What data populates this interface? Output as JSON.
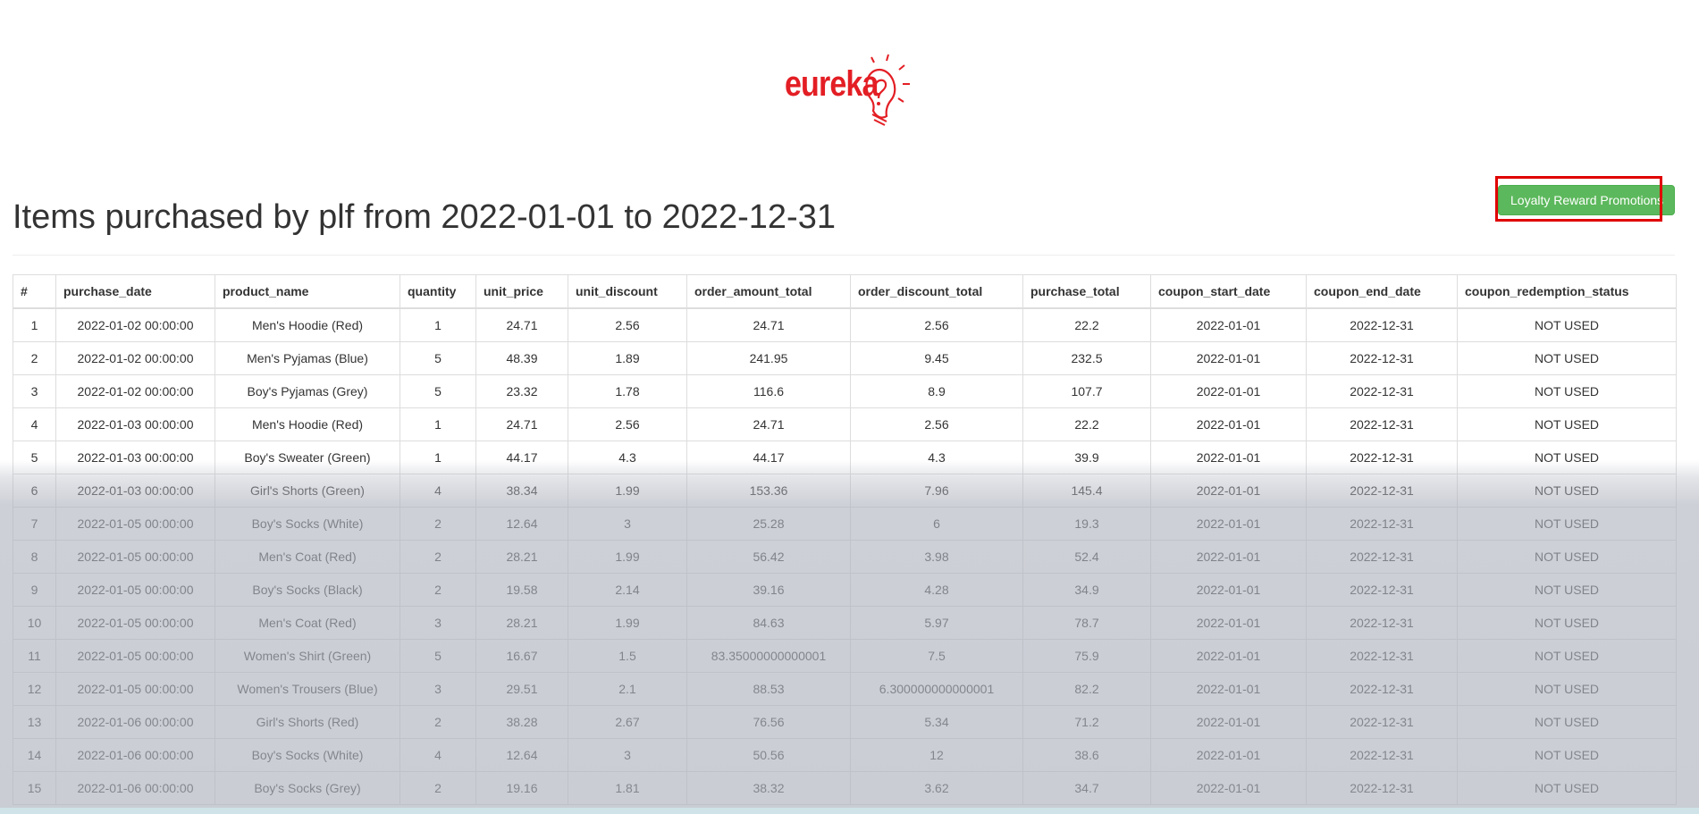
{
  "logo": {
    "text": "eureka"
  },
  "page_title": "Items purchased by plf from 2022-01-01 to 2022-12-31",
  "promo_button_label": "Loyalty Reward Promotions",
  "table": {
    "columns": [
      "#",
      "purchase_date",
      "product_name",
      "quantity",
      "unit_price",
      "unit_discount",
      "order_amount_total",
      "order_discount_total",
      "purchase_total",
      "coupon_start_date",
      "coupon_end_date",
      "coupon_redemption_status"
    ],
    "rows": [
      [
        "1",
        "2022-01-02 00:00:00",
        "Men's Hoodie (Red)",
        "1",
        "24.71",
        "2.56",
        "24.71",
        "2.56",
        "22.2",
        "2022-01-01",
        "2022-12-31",
        "NOT USED"
      ],
      [
        "2",
        "2022-01-02 00:00:00",
        "Men's Pyjamas (Blue)",
        "5",
        "48.39",
        "1.89",
        "241.95",
        "9.45",
        "232.5",
        "2022-01-01",
        "2022-12-31",
        "NOT USED"
      ],
      [
        "3",
        "2022-01-02 00:00:00",
        "Boy's Pyjamas (Grey)",
        "5",
        "23.32",
        "1.78",
        "116.6",
        "8.9",
        "107.7",
        "2022-01-01",
        "2022-12-31",
        "NOT USED"
      ],
      [
        "4",
        "2022-01-03 00:00:00",
        "Men's Hoodie (Red)",
        "1",
        "24.71",
        "2.56",
        "24.71",
        "2.56",
        "22.2",
        "2022-01-01",
        "2022-12-31",
        "NOT USED"
      ],
      [
        "5",
        "2022-01-03 00:00:00",
        "Boy's Sweater (Green)",
        "1",
        "44.17",
        "4.3",
        "44.17",
        "4.3",
        "39.9",
        "2022-01-01",
        "2022-12-31",
        "NOT USED"
      ],
      [
        "6",
        "2022-01-03 00:00:00",
        "Girl's Shorts (Green)",
        "4",
        "38.34",
        "1.99",
        "153.36",
        "7.96",
        "145.4",
        "2022-01-01",
        "2022-12-31",
        "NOT USED"
      ],
      [
        "7",
        "2022-01-05 00:00:00",
        "Boy's Socks (White)",
        "2",
        "12.64",
        "3",
        "25.28",
        "6",
        "19.3",
        "2022-01-01",
        "2022-12-31",
        "NOT USED"
      ],
      [
        "8",
        "2022-01-05 00:00:00",
        "Men's Coat (Red)",
        "2",
        "28.21",
        "1.99",
        "56.42",
        "3.98",
        "52.4",
        "2022-01-01",
        "2022-12-31",
        "NOT USED"
      ],
      [
        "9",
        "2022-01-05 00:00:00",
        "Boy's Socks (Black)",
        "2",
        "19.58",
        "2.14",
        "39.16",
        "4.28",
        "34.9",
        "2022-01-01",
        "2022-12-31",
        "NOT USED"
      ],
      [
        "10",
        "2022-01-05 00:00:00",
        "Men's Coat (Red)",
        "3",
        "28.21",
        "1.99",
        "84.63",
        "5.97",
        "78.7",
        "2022-01-01",
        "2022-12-31",
        "NOT USED"
      ],
      [
        "11",
        "2022-01-05 00:00:00",
        "Women's Shirt (Green)",
        "5",
        "16.67",
        "1.5",
        "83.35000000000001",
        "7.5",
        "75.9",
        "2022-01-01",
        "2022-12-31",
        "NOT USED"
      ],
      [
        "12",
        "2022-01-05 00:00:00",
        "Women's Trousers (Blue)",
        "3",
        "29.51",
        "2.1",
        "88.53",
        "6.300000000000001",
        "82.2",
        "2022-01-01",
        "2022-12-31",
        "NOT USED"
      ],
      [
        "13",
        "2022-01-06 00:00:00",
        "Girl's Shorts (Red)",
        "2",
        "38.28",
        "2.67",
        "76.56",
        "5.34",
        "71.2",
        "2022-01-01",
        "2022-12-31",
        "NOT USED"
      ],
      [
        "14",
        "2022-01-06 00:00:00",
        "Boy's Socks (White)",
        "4",
        "12.64",
        "3",
        "50.56",
        "12",
        "38.6",
        "2022-01-01",
        "2022-12-31",
        "NOT USED"
      ],
      [
        "15",
        "2022-01-06 00:00:00",
        "Boy's Socks (Grey)",
        "2",
        "19.16",
        "1.81",
        "38.32",
        "3.62",
        "34.7",
        "2022-01-01",
        "2022-12-31",
        "NOT USED"
      ]
    ]
  },
  "colors": {
    "logo_red": "#e31e24",
    "button_green": "#5cb85c",
    "highlight_red": "#e00000"
  }
}
